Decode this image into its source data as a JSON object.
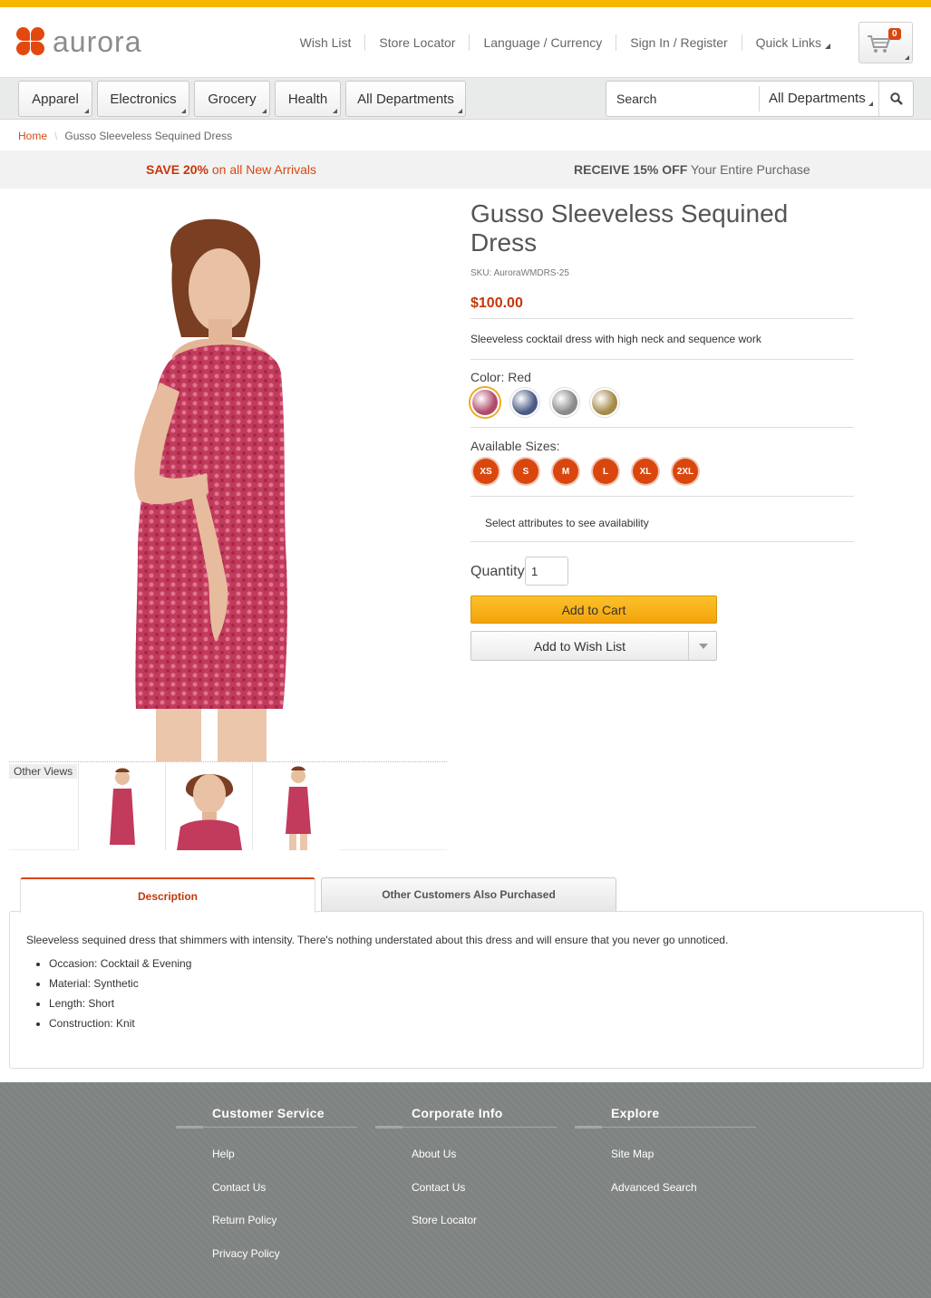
{
  "brand": {
    "name": "aurora",
    "accent": "#d9470f",
    "topbar": "#f7b500"
  },
  "header_links": [
    "Wish List",
    "Store Locator",
    "Language / Currency",
    "Sign In / Register",
    "Quick Links"
  ],
  "cart": {
    "count": "0"
  },
  "departments": [
    "Apparel",
    "Electronics",
    "Grocery",
    "Health",
    "All Departments"
  ],
  "search": {
    "placeholder": "Search",
    "department": "All Departments"
  },
  "breadcrumb": {
    "home": "Home",
    "current": "Gusso Sleeveless Sequined Dress"
  },
  "promos": {
    "left_strong": "SAVE 20%",
    "left_rest": " on all New Arrivals",
    "right_strong": "RECEIVE 15% OFF",
    "right_rest": " Your Entire Purchase"
  },
  "product": {
    "title": "Gusso Sleeveless Sequined Dress",
    "sku": "SKU: AuroraWMDRS-25",
    "price": "$100.00",
    "short_description": "Sleeveless cocktail dress with high neck and sequence work",
    "color_label": "Color: Red",
    "colors": [
      {
        "name": "Red",
        "hex": "#b04a6a",
        "selected": true
      },
      {
        "name": "Blue",
        "hex": "#4b5a86",
        "selected": false
      },
      {
        "name": "Silver",
        "hex": "#8a8a8a",
        "selected": false
      },
      {
        "name": "Gold",
        "hex": "#a58a48",
        "selected": false
      }
    ],
    "sizes_label": "Available Sizes:",
    "sizes": [
      "XS",
      "S",
      "M",
      "L",
      "XL",
      "2XL"
    ],
    "availability": "Select attributes to see availability",
    "quantity_label": "Quantity",
    "quantity": "1",
    "add_to_cart": "Add to Cart",
    "add_to_wishlist": "Add to Wish List"
  },
  "other_views_label": "Other Views",
  "tabs": [
    "Description",
    "Other Customers Also Purchased"
  ],
  "description": {
    "text": "Sleeveless sequined dress that shimmers with intensity. There's nothing understated about this dress and will ensure that you never go unnoticed.",
    "bullets": [
      "Occasion: Cocktail & Evening",
      "Material: Synthetic",
      "Length: Short",
      "Construction: Knit"
    ]
  },
  "footer": [
    {
      "title": "Customer Service",
      "links": [
        "Help",
        "Contact Us",
        "Return Policy",
        "Privacy Policy"
      ]
    },
    {
      "title": "Corporate Info",
      "links": [
        "About Us",
        "Contact Us",
        "Store Locator"
      ]
    },
    {
      "title": "Explore",
      "links": [
        "Site Map",
        "Advanced Search"
      ]
    }
  ]
}
